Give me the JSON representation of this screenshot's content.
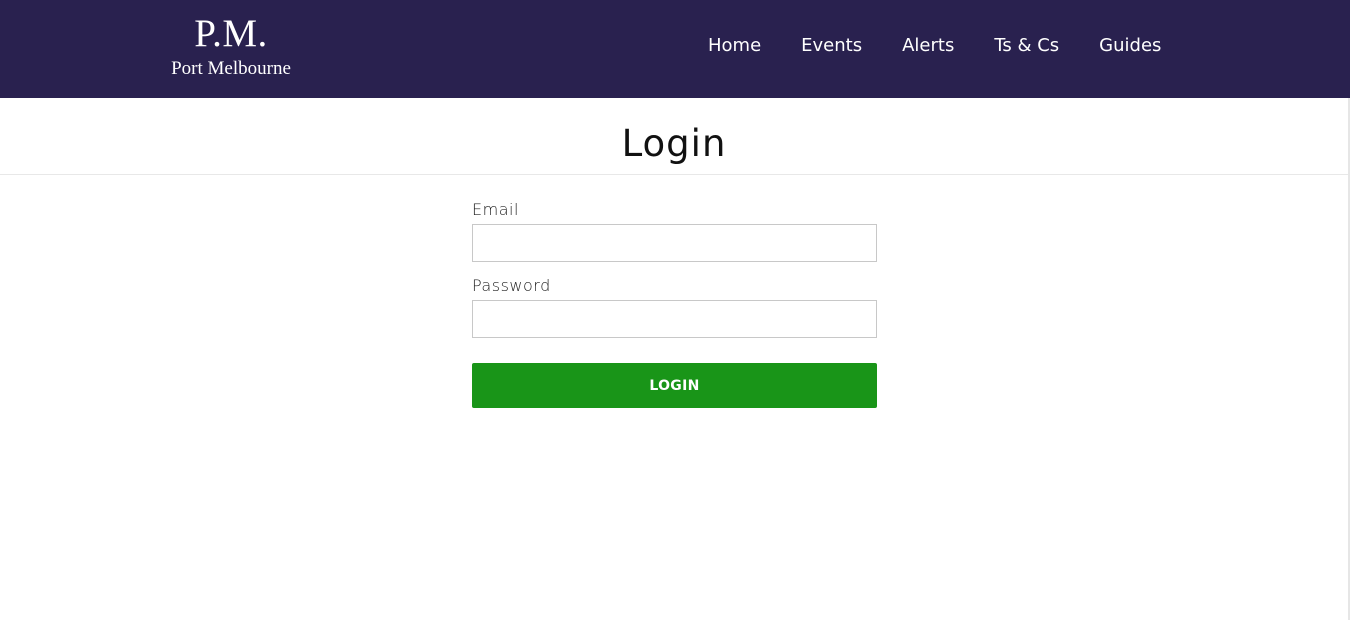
{
  "brand": {
    "mark": "P.M.",
    "subtitle": "Port Melbourne"
  },
  "nav": {
    "items": [
      {
        "label": "Home"
      },
      {
        "label": "Events"
      },
      {
        "label": "Alerts"
      },
      {
        "label": "Ts & Cs"
      },
      {
        "label": "Guides"
      }
    ]
  },
  "page": {
    "title": "Login"
  },
  "form": {
    "email": {
      "label": "Email",
      "value": "",
      "placeholder": ""
    },
    "password": {
      "label": "Password",
      "value": "",
      "placeholder": ""
    },
    "submit_label": "LOGIN"
  },
  "colors": {
    "navbar_bg": "#29214f",
    "nav_text": "#ffffff",
    "button_bg": "#199518",
    "button_text": "#ffffff"
  }
}
